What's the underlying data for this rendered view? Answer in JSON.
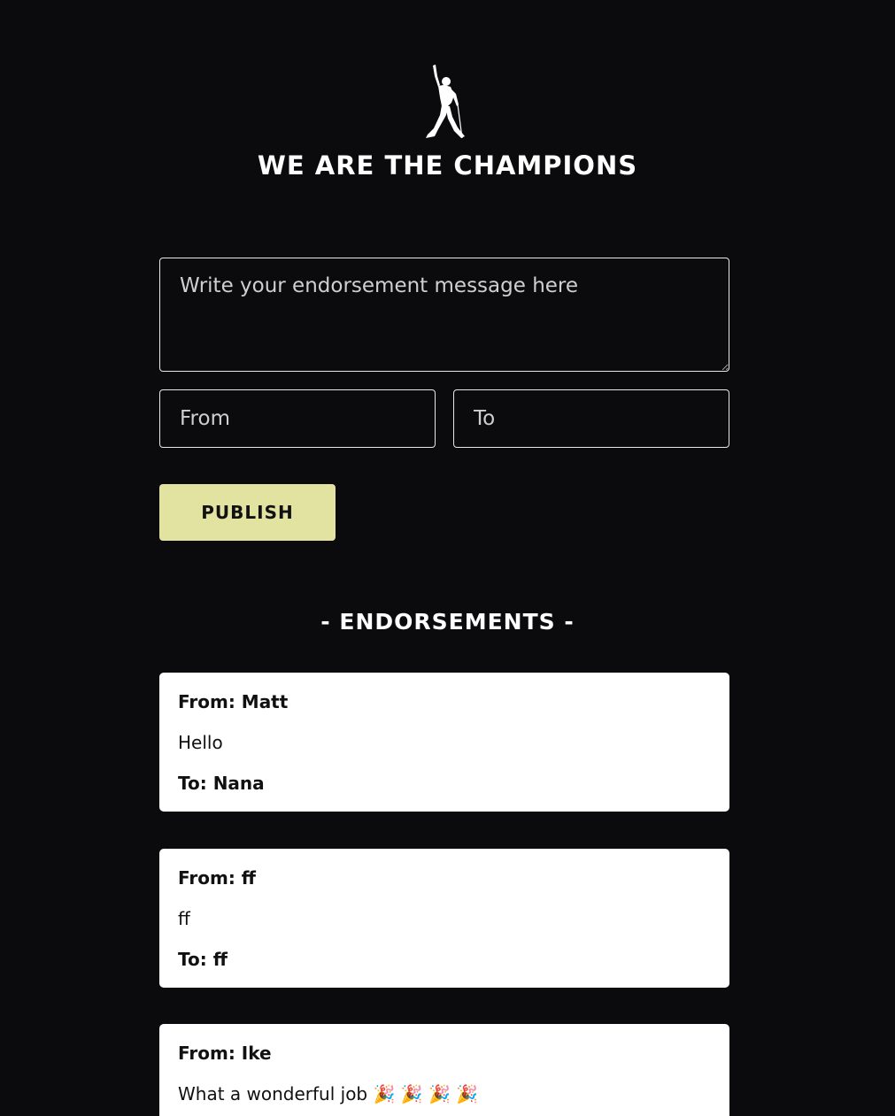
{
  "header": {
    "logo_icon": "singer-silhouette-icon",
    "title": "WE ARE THE CHAMPIONS"
  },
  "form": {
    "message_placeholder": "Write your endorsement message here",
    "from_placeholder": "From",
    "to_placeholder": "To",
    "publish_label": "PUBLISH"
  },
  "endorsements": {
    "heading": "- ENDORSEMENTS -",
    "items": [
      {
        "from": "From: Matt",
        "message": "Hello",
        "to": "To: Nana"
      },
      {
        "from": "From: ff",
        "message": "ff",
        "to": "To: ff"
      },
      {
        "from": "From: Ike",
        "message": "What a wonderful job 🎉 🎉 🎉 🎉",
        "to": ""
      }
    ]
  },
  "colors": {
    "background": "#0b0b0d",
    "accent_button": "#e3e3a1",
    "card": "#ffffff"
  }
}
